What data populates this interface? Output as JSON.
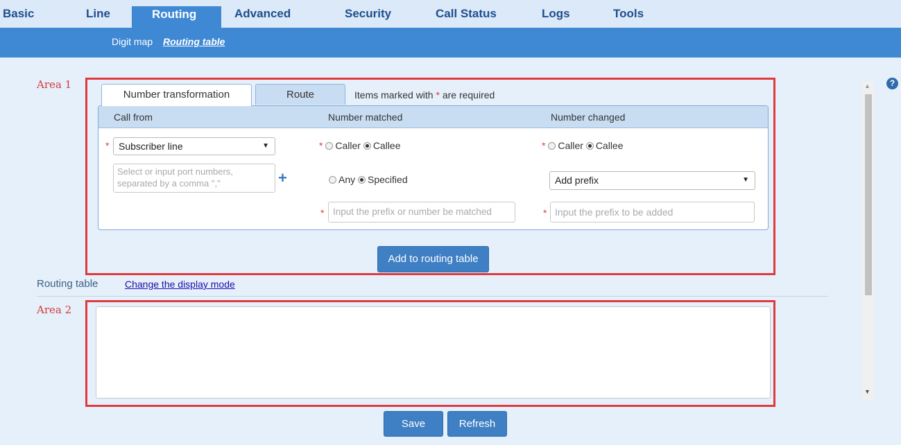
{
  "nav": {
    "tabs": [
      "Basic",
      "Line",
      "Routing",
      "Advanced",
      "Security",
      "Call Status",
      "Logs",
      "Tools"
    ],
    "active": "Routing"
  },
  "subnav": {
    "items": [
      "Digit map",
      "Routing table"
    ],
    "active": "Routing table"
  },
  "areas": {
    "area1": "Area 1",
    "area2": "Area 2"
  },
  "form_tabs": {
    "number_transformation": "Number transformation",
    "route": "Route"
  },
  "required_note": {
    "prefix": "Items marked with ",
    "star": "*",
    "suffix": " are required"
  },
  "columns": {
    "call_from": "Call from",
    "number_matched": "Number matched",
    "number_changed": "Number changed"
  },
  "call_from": {
    "line_select": "Subscriber line",
    "ports_placeholder_line1": "Select or input port numbers,",
    "ports_placeholder_line2": "separated by a comma \",\""
  },
  "number_matched": {
    "caller": "Caller",
    "callee": "Callee",
    "any": "Any",
    "specified": "Specified",
    "prefix_placeholder": "Input the prefix or number be matched"
  },
  "number_changed": {
    "caller": "Caller",
    "callee": "Callee",
    "action_select": "Add prefix",
    "prefix_placeholder": "Input the prefix to be added"
  },
  "buttons": {
    "add": "Add to routing table",
    "save": "Save",
    "refresh": "Refresh"
  },
  "routing_table": {
    "label": "Routing table",
    "link": "Change the display mode"
  },
  "help": "?",
  "colors": {
    "nav_active": "#3f88d3",
    "accent": "#3f7fc4",
    "required": "#e0393e"
  }
}
